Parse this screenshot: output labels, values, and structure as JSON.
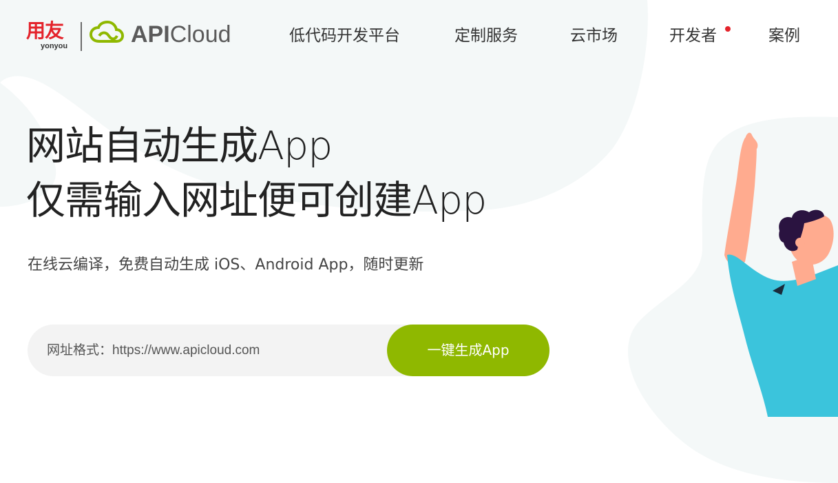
{
  "header": {
    "logo_cn": "用友",
    "logo_en": "yonyou",
    "logo_brand_bold": "API",
    "logo_brand_light": "Cloud",
    "nav": [
      {
        "label": "低代码开发平台"
      },
      {
        "label": "定制服务"
      },
      {
        "label": "云市场"
      },
      {
        "label": "开发者",
        "has_dot": true
      },
      {
        "label": "案例"
      }
    ]
  },
  "hero": {
    "title_line1": "网站自动生成App",
    "title_line2": "仅需输入网址便可创建App",
    "subtitle": "在线云编译，免费自动生成 iOS、Android App，随时更新",
    "input_placeholder": "网址格式：https://www.apicloud.com",
    "button_label": "一键生成App"
  },
  "colors": {
    "accent_green": "#8fb800",
    "brand_red": "#e4232b",
    "bg_blob": "#f4f8f8"
  }
}
